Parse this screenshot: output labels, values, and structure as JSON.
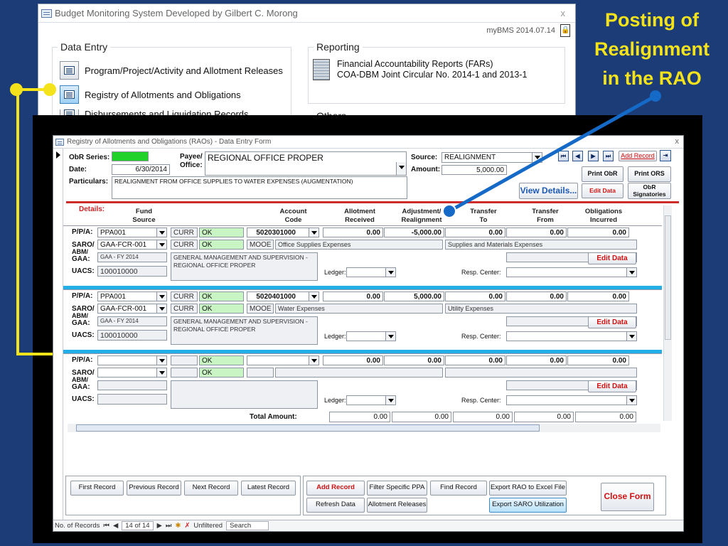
{
  "headline": {
    "line1": "Posting of",
    "line2": "Realignment",
    "line3": "in the RAO"
  },
  "menu_window": {
    "title": "Budget Monitoring System Developed by Gilbert C. Morong",
    "version": "myBMS 2014.07.14",
    "close": "x",
    "data_entry": {
      "heading": "Data Entry",
      "items": [
        "Program/Project/Activity and Allotment Releases",
        "Registry of Allotments and Obligations",
        "Disbursements and Liquidation Records"
      ]
    },
    "reporting": {
      "heading": "Reporting",
      "line1": "Financial Accountability Reports (FARs)",
      "line2": "COA-DBM Joint Circular No. 2014-1 and 2013-1"
    },
    "others": {
      "heading": "Others"
    }
  },
  "form": {
    "title": "Registry of Allotments and Obligations (RAOs) - Data Entry Form",
    "close": "x",
    "obr_series_label": "ObR Series:",
    "obr_series_value": "",
    "date_label": "Date:",
    "date_value": "6/30/2014",
    "particulars_label": "Particulars:",
    "particulars_value": "REALIGNMENT FROM OFFICE SUPPLIES TO WATER EXPENSES (AUGMENTATION)",
    "payee_label1": "Payee/",
    "payee_label2": "Office:",
    "payee_value": "REGIONAL OFFICE PROPER",
    "source_label": "Source:",
    "source_value": "REALIGNMENT",
    "amount_label": "Amount:",
    "amount_value": "5,000.00",
    "nav": [
      "⏮",
      "◀",
      "▶",
      "⏭"
    ],
    "buttons": {
      "add_record": "Add Record",
      "print_obr": "Print ObR",
      "print_ors": "Print ORS",
      "view_details": "View Details...",
      "edit_data": "Edit Data",
      "obr_sig1": "ObR",
      "obr_sig2": "Signatories"
    },
    "details_label": "Details:",
    "columns": [
      {
        "l1": "Fund",
        "l2": "Source"
      },
      {
        "l1": "Account",
        "l2": "Code"
      },
      {
        "l1": "Allotment",
        "l2": "Received"
      },
      {
        "l1": "Adjustment/",
        "l2": "Realignment"
      },
      {
        "l1": "Transfer",
        "l2": "To"
      },
      {
        "l1": "Transfer",
        "l2": "From"
      },
      {
        "l1": "Obligations",
        "l2": "Incurred"
      }
    ],
    "row_labels": {
      "ppa": "P/P/A:",
      "saro": "SARO/",
      "abm": "ABM/",
      "gaa": "GAA:",
      "uacs": "UACS:",
      "ledger": "Ledger:",
      "resp": "Resp. Center:",
      "edit": "Edit Data"
    },
    "rows": [
      {
        "ppa": "PPA001",
        "fund": "CURR",
        "ok1": "OK",
        "account": "5020301000",
        "allot": "0.00",
        "adjust": "-5,000.00",
        "tto": "0.00",
        "tfrom": "0.00",
        "oblig": "0.00",
        "saro": "GAA-FCR-001",
        "fund2": "CURR",
        "ok2": "OK",
        "mooe": "MOOE",
        "expense": "Office Supplies Expenses",
        "expense_class": "Supplies and Materials Expenses",
        "gaa": "GAA - FY 2014",
        "desc1": "GENERAL MANAGEMENT AND SUPERVISION -",
        "desc2": "REGIONAL OFFICE PROPER",
        "uacs": "100010000"
      },
      {
        "ppa": "PPA001",
        "fund": "CURR",
        "ok1": "OK",
        "account": "5020401000",
        "allot": "0.00",
        "adjust": "5,000.00",
        "tto": "0.00",
        "tfrom": "0.00",
        "oblig": "0.00",
        "saro": "GAA-FCR-001",
        "fund2": "CURR",
        "ok2": "OK",
        "mooe": "MOOE",
        "expense": "Water Expenses",
        "expense_class": "Utility Expenses",
        "gaa": "GAA - FY 2014",
        "desc1": "GENERAL MANAGEMENT AND SUPERVISION -",
        "desc2": "REGIONAL OFFICE PROPER",
        "uacs": "100010000"
      },
      {
        "ppa": "",
        "fund": "",
        "ok1": "OK",
        "account": "",
        "allot": "0.00",
        "adjust": "0.00",
        "tto": "0.00",
        "tfrom": "0.00",
        "oblig": "0.00",
        "saro": "",
        "fund2": "",
        "ok2": "OK",
        "mooe": "",
        "expense": "",
        "expense_class": "",
        "gaa": "",
        "desc1": "",
        "desc2": "",
        "uacs": ""
      }
    ],
    "total_label": "Total Amount:",
    "totals": [
      "0.00",
      "0.00",
      "0.00",
      "0.00",
      "0.00"
    ],
    "bottom_buttons": {
      "first": "First Record",
      "previous": "Previous Record",
      "next": "Next Record",
      "latest": "Latest Record",
      "add": "Add Record",
      "filter": "Filter Specific PPA",
      "find": "Find Record",
      "export_rao": "Export RAO to Excel File",
      "refresh": "Refresh Data",
      "allotment": "Allotment Releases",
      "export_saro": "Export SARO Utilization",
      "close": "Close Form"
    },
    "status": {
      "label": "No. of Records",
      "record": "14 of 14",
      "filter": "Unfiltered",
      "search": "Search"
    }
  },
  "colors": {
    "background": "#1c3c78",
    "headline": "#f4e31a",
    "connector_blue": "#1569c7",
    "row_separator": "#22aee6",
    "details_red": "#cf2b2b"
  }
}
